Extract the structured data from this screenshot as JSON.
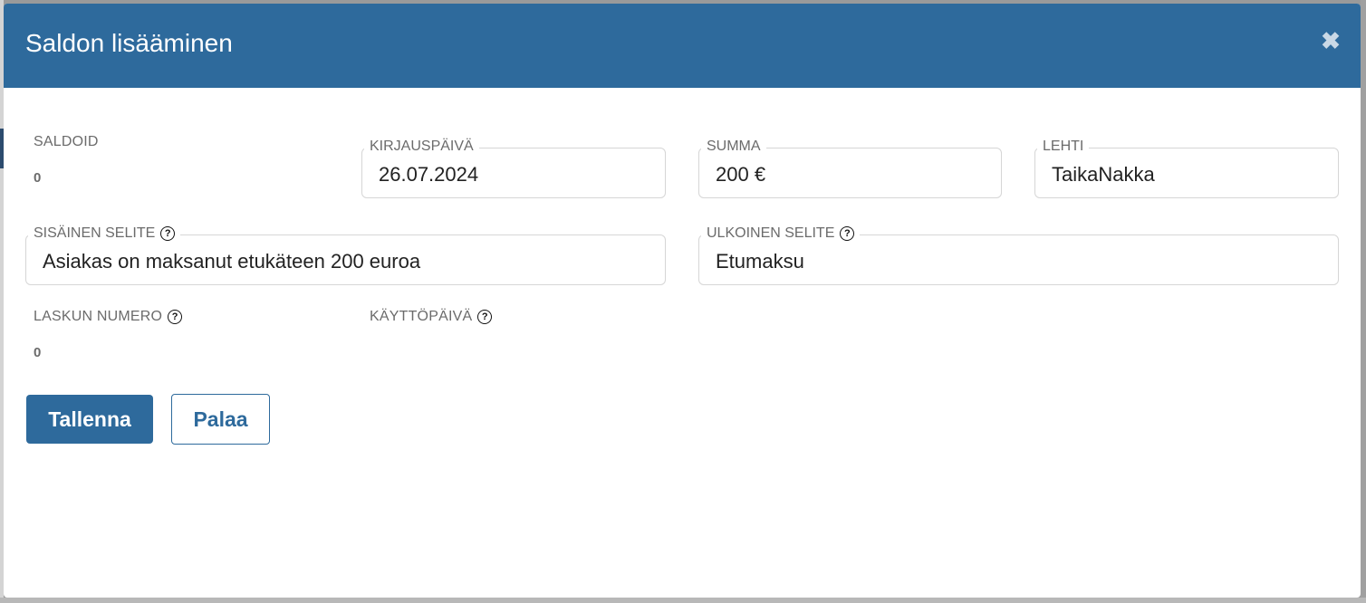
{
  "modal": {
    "title": "Saldon lisääminen",
    "close_icon": "close-icon"
  },
  "fields": {
    "saldoid": {
      "label": "SALDOID",
      "value": "0"
    },
    "kirjauspaiva": {
      "label": "KIRJAUSPÄIVÄ",
      "value": "26.07.2024"
    },
    "summa": {
      "label": "SUMMA",
      "value": "200 €"
    },
    "lehti": {
      "label": "LEHTI",
      "value": "TaikaNakka"
    },
    "sisainen_selite": {
      "label": "SISÄINEN SELITE",
      "value": "Asiakas on maksanut etukäteen 200 euroa",
      "help_icon": "question-icon"
    },
    "ulkoinen_selite": {
      "label": "ULKOINEN SELITE",
      "value": "Etumaksu",
      "help_icon": "question-icon"
    },
    "laskun_numero": {
      "label": "LASKUN NUMERO",
      "value": "0",
      "help_icon": "question-icon"
    },
    "kayttopaiva": {
      "label": "KÄYTTÖPÄIVÄ",
      "help_icon": "question-icon"
    }
  },
  "buttons": {
    "save": "Tallenna",
    "back": "Palaa"
  },
  "colors": {
    "header": "#2e6a9c",
    "primary": "#2e6a9c"
  }
}
